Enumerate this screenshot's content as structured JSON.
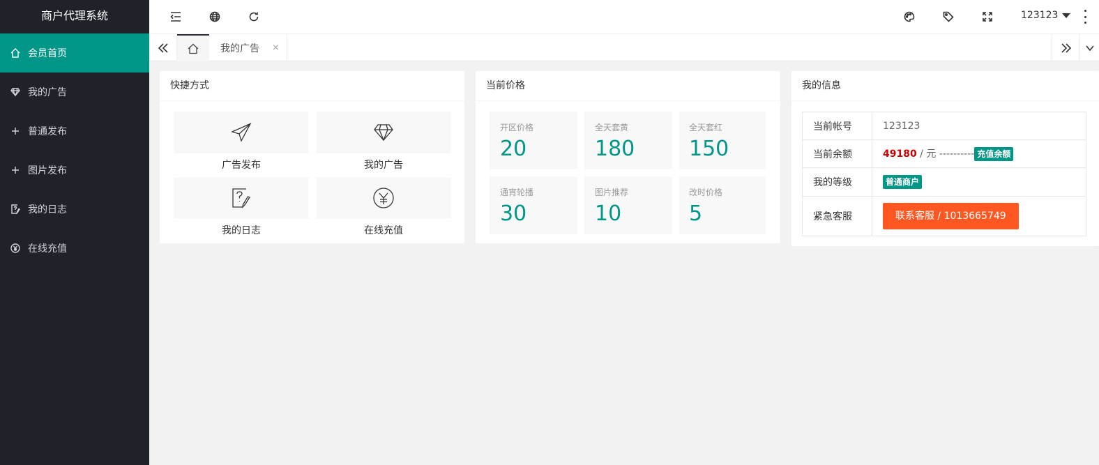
{
  "app": {
    "title": "商户代理系统"
  },
  "sidebar": {
    "items": [
      {
        "label": "会员首页",
        "icon": "home-icon",
        "active": true
      },
      {
        "label": "我的广告",
        "icon": "diamond-icon"
      },
      {
        "label": "普通发布",
        "icon": "plus-icon"
      },
      {
        "label": "图片发布",
        "icon": "plus-icon"
      },
      {
        "label": "我的日志",
        "icon": "log-icon"
      },
      {
        "label": "在线充值",
        "icon": "yen-icon"
      }
    ]
  },
  "header": {
    "icons": [
      "menu-fold-icon",
      "globe-icon",
      "refresh-icon",
      "palette-icon",
      "tag-icon",
      "fullscreen-icon"
    ],
    "user": "123123"
  },
  "tabs": {
    "home_icon": "home-icon",
    "items": [
      {
        "label": "我的广告",
        "close": "×"
      }
    ]
  },
  "shortcuts": {
    "title": "快捷方式",
    "items": [
      {
        "label": "广告发布",
        "icon": "paper-plane-icon"
      },
      {
        "label": "我的广告",
        "icon": "diamond-icon"
      },
      {
        "label": "我的日志",
        "icon": "log-edit-icon"
      },
      {
        "label": "在线充值",
        "icon": "yen-circle-icon"
      }
    ]
  },
  "prices": {
    "title": "当前价格",
    "items": [
      {
        "label": "开区价格",
        "value": "20"
      },
      {
        "label": "全天套黄",
        "value": "180"
      },
      {
        "label": "全天套红",
        "value": "150"
      },
      {
        "label": "通宵轮播",
        "value": "30"
      },
      {
        "label": "图片推荐",
        "value": "10"
      },
      {
        "label": "改时价格",
        "value": "5"
      }
    ]
  },
  "info": {
    "title": "我的信息",
    "account_label": "当前帐号",
    "account_value": "123123",
    "balance_label": "当前余额",
    "balance_value": "49180",
    "balance_unit": " / 元 ----------",
    "recharge_badge": "充值余额",
    "level_label": "我的等级",
    "level_badge": "普通商户",
    "service_label": "紧急客服",
    "service_button": "联系客服 / 1013665749"
  },
  "colors": {
    "accent": "#009688",
    "sidebar": "#20222a",
    "danger": "#ff5722",
    "balance": "#cc0000"
  }
}
